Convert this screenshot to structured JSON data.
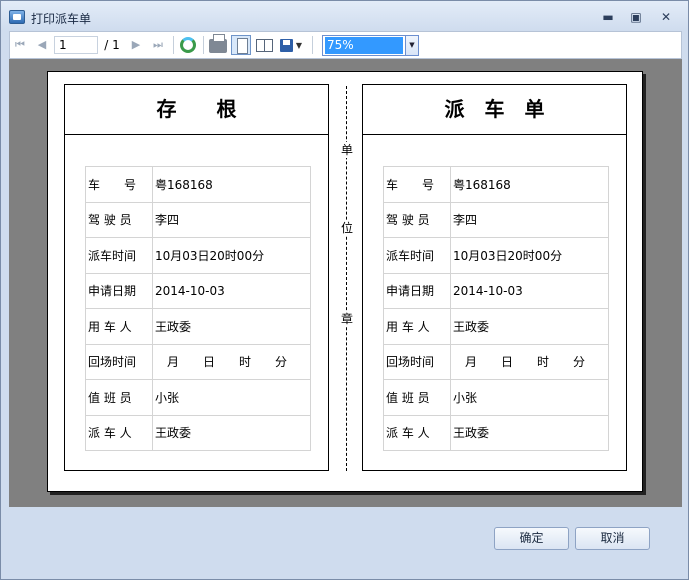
{
  "window": {
    "title": "打印派车单",
    "controls": {
      "minimize": "▬",
      "maximize": "▣",
      "close": "✕"
    }
  },
  "toolbar": {
    "nav": {
      "first": "⏮",
      "prev": "◀",
      "next": "▶",
      "last": "⏭"
    },
    "page_current": "1",
    "page_total": "/ 1",
    "zoom": "75%",
    "icons": [
      "first-page-icon",
      "prev-page-icon",
      "next-page-icon",
      "last-page-icon",
      "refresh-icon",
      "print-icon",
      "page-layout-icon",
      "page-setup-icon",
      "save-icon"
    ]
  },
  "report": {
    "stub_title": "存　　根",
    "main_title": "派　车　单",
    "divider_chars": [
      "单",
      "位",
      "章"
    ],
    "rows": [
      {
        "label": "车　　号",
        "value": "粤168168"
      },
      {
        "label": "驾 驶 员",
        "value": "李四"
      },
      {
        "label": "派车时间",
        "value": "10月03日20时00分"
      },
      {
        "label": "申请日期",
        "value": "2014-10-03"
      },
      {
        "label": "用 车 人",
        "value": "王政委"
      },
      {
        "label": "回场时间",
        "value": ""
      },
      {
        "label": "值 班 员",
        "value": "小张"
      },
      {
        "label": "派 车 人",
        "value": "王政委"
      }
    ],
    "return_time_units": [
      "月",
      "日",
      "时",
      "分"
    ]
  },
  "buttons": {
    "ok": "确定",
    "cancel": "取消"
  }
}
